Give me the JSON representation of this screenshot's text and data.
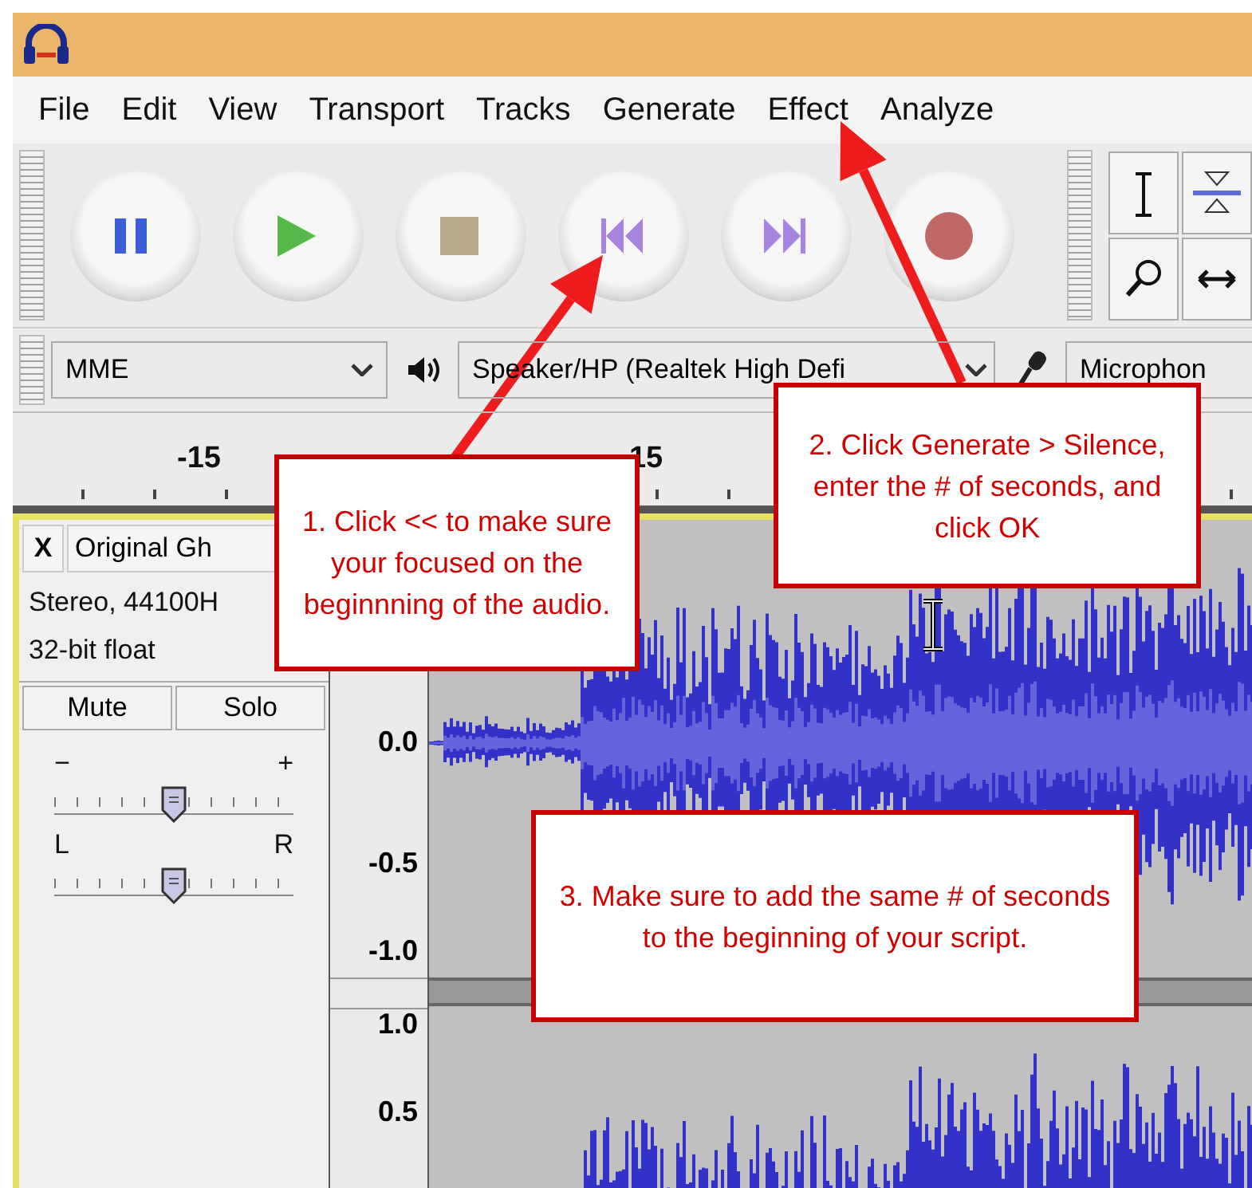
{
  "menu": [
    {
      "label": "File"
    },
    {
      "label": "Edit"
    },
    {
      "label": "View"
    },
    {
      "label": "Transport"
    },
    {
      "label": "Tracks"
    },
    {
      "label": "Generate"
    },
    {
      "label": "Effect"
    },
    {
      "label": "Analyze"
    }
  ],
  "device_toolbar": {
    "host": "MME",
    "playback_device": "Speaker/HP (Realtek High Defi",
    "recording_device": "Microphon"
  },
  "ruler": {
    "ticks": [
      "-15",
      "15"
    ]
  },
  "track": {
    "close": "X",
    "name": "Original Gh",
    "info": [
      "Stereo, 44100H",
      "32-bit float"
    ],
    "buttons": [
      "Mute",
      "Solo"
    ],
    "gain": {
      "minus": "−",
      "plus": "+",
      "level": 0.5
    },
    "pan": {
      "left": "L",
      "right": "R",
      "level": 0.5
    },
    "channel_1_scale": [
      "0.0",
      "-0.5",
      "-1.0"
    ],
    "channel_2_scale": [
      "1.0",
      "0.5"
    ]
  },
  "callouts": [
    {
      "text": "1. Click << to make sure your focused on the beginnning of the audio."
    },
    {
      "text": "2. Click Generate > Silence, enter the # of seconds, and click OK"
    },
    {
      "text": "3. Make sure to add the same # of seconds to the beginning of your script."
    }
  ]
}
